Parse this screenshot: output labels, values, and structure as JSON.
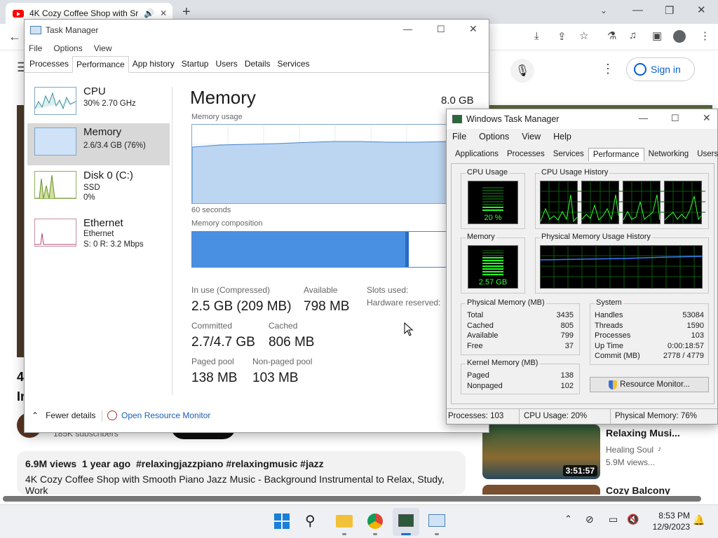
{
  "browser": {
    "tab_title": "4K Cozy Coffee Shop with Sr",
    "new_tab": "+"
  },
  "youtube": {
    "sign_in": "Sign in",
    "subscribers": "185K subscribers",
    "video_left_partial": "4",
    "video_left_partial2": "In",
    "views_line": "6.9M views  1 year ago  #relaxingjazzpiano #relaxingmusic #jazz",
    "description": "4K Cozy Coffee Shop with Smooth Piano Jazz Music - Background Instrumental to Relax, Study,",
    "description2": "Work",
    "side_video": {
      "title": "Relaxing Musi...",
      "channel": "Healing Soul",
      "views": "5.9M views...",
      "duration": "3:51:57"
    },
    "side_video2": {
      "title": "Cozy Balcony"
    }
  },
  "task_manager": {
    "title": "Task Manager",
    "menu": [
      "File",
      "Options",
      "View"
    ],
    "tabs": [
      "Processes",
      "Performance",
      "App history",
      "Startup",
      "Users",
      "Details",
      "Services"
    ],
    "sidebar": [
      {
        "name": "CPU",
        "sub1": "30%  2.70 GHz",
        "sub2": ""
      },
      {
        "name": "Memory",
        "sub1": "2.6/3.4 GB (76%)",
        "sub2": ""
      },
      {
        "name": "Disk 0 (C:)",
        "sub1": "SSD",
        "sub2": "0%"
      },
      {
        "name": "Ethernet",
        "sub1": "Ethernet",
        "sub2": "S: 0  R: 3.2 Mbps"
      }
    ],
    "heading": "Memory",
    "total": "8.0 GB",
    "usage_label": "Memory usage",
    "seconds": "60 seconds",
    "composition_label": "Memory composition",
    "stats": {
      "in_use_label": "In use (Compressed)",
      "in_use": "2.5 GB (209 MB)",
      "available_label": "Available",
      "available": "798 MB",
      "slots_label": "Slots used:",
      "hw_label": "Hardware reserved:",
      "committed_label": "Committed",
      "committed": "2.7/4.7 GB",
      "cached_label": "Cached",
      "cached": "806 MB",
      "paged_label": "Paged pool",
      "paged": "138 MB",
      "nonpaged_label": "Non-paged pool",
      "nonpaged": "103 MB"
    },
    "fewer_details": "Fewer details",
    "open_resmon": "Open Resource Monitor"
  },
  "classic_tm": {
    "title": "Windows Task Manager",
    "menu": [
      "File",
      "Options",
      "View",
      "Help"
    ],
    "tabs": [
      "Applications",
      "Processes",
      "Services",
      "Performance",
      "Networking",
      "Users"
    ],
    "cpu_usage_label": "CPU Usage",
    "cpu_value": "20 %",
    "cpu_history_label": "CPU Usage History",
    "memory_label": "Memory",
    "memory_value": "2.57 GB",
    "pm_history_label": "Physical Memory Usage History",
    "physical_memory": {
      "label": "Physical Memory (MB)",
      "rows": [
        [
          "Total",
          "3435"
        ],
        [
          "Cached",
          "805"
        ],
        [
          "Available",
          "799"
        ],
        [
          "Free",
          "37"
        ]
      ]
    },
    "system": {
      "label": "System",
      "rows": [
        [
          "Handles",
          "53084"
        ],
        [
          "Threads",
          "1590"
        ],
        [
          "Processes",
          "103"
        ],
        [
          "Up Time",
          "0:00:18:57"
        ],
        [
          "Commit (MB)",
          "2778 / 4779"
        ]
      ]
    },
    "kernel_memory": {
      "label": "Kernel Memory (MB)",
      "rows": [
        [
          "Paged",
          "138"
        ],
        [
          "Nonpaged",
          "102"
        ]
      ]
    },
    "resmon_button": "Resource Monitor...",
    "status": {
      "processes": "Processes: 103",
      "cpu": "CPU Usage: 20%",
      "memory": "Physical Memory: 76%"
    }
  },
  "taskbar": {
    "time": "8:53 PM",
    "date": "12/9/2023"
  }
}
